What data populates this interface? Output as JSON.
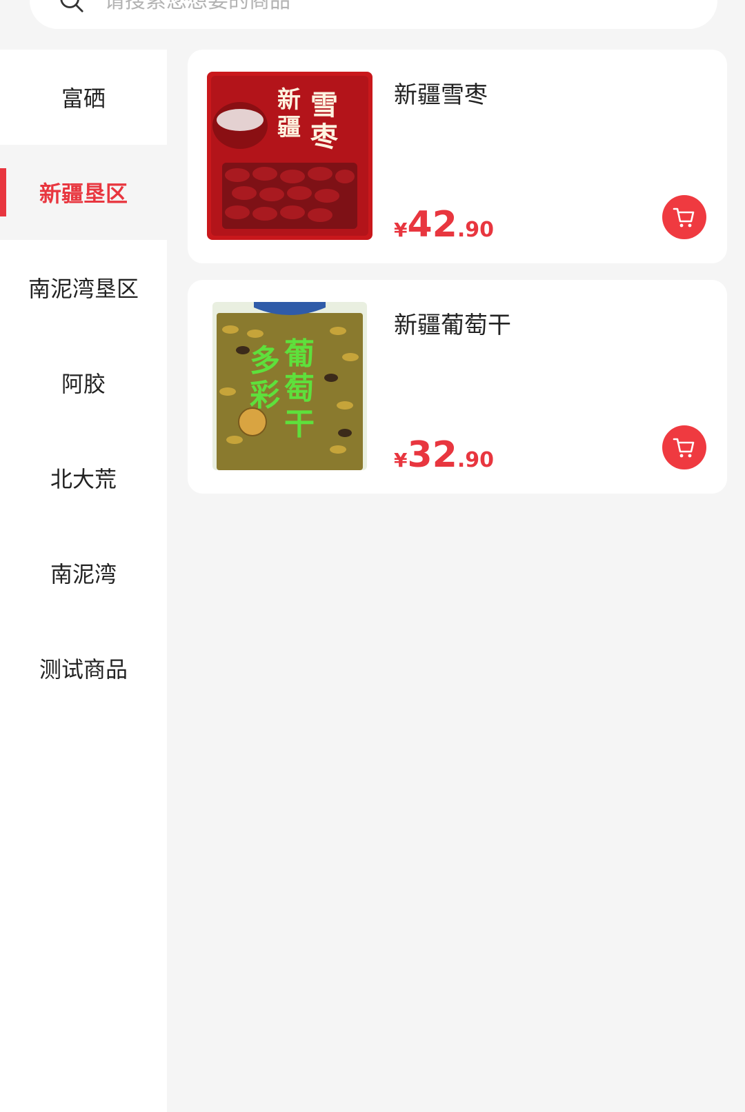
{
  "search": {
    "placeholder": "请搜索您想要的商品",
    "icon": "search-icon"
  },
  "categories": [
    {
      "label": "富硒",
      "active": false
    },
    {
      "label": "新疆垦区",
      "active": true
    },
    {
      "label": "南泥湾垦区",
      "active": false
    },
    {
      "label": "阿胶",
      "active": false
    },
    {
      "label": "北大荒",
      "active": false
    },
    {
      "label": "南泥湾",
      "active": false
    },
    {
      "label": "测试商品",
      "active": false
    }
  ],
  "products": [
    {
      "name": "新疆雪枣",
      "price_symbol": "¥",
      "price_int": "42",
      "price_dec": ".90",
      "image_text": [
        "新",
        "疆",
        "雪",
        "枣"
      ],
      "cart_icon": "cart-icon"
    },
    {
      "name": "新疆葡萄干",
      "price_symbol": "¥",
      "price_int": "32",
      "price_dec": ".90",
      "image_text": [
        "多",
        "彩",
        "葡",
        "萄",
        "干"
      ],
      "cart_icon": "cart-icon"
    }
  ],
  "colors": {
    "accent": "#e8363f",
    "background": "#f5f5f5",
    "card": "#ffffff",
    "text": "#222222"
  }
}
